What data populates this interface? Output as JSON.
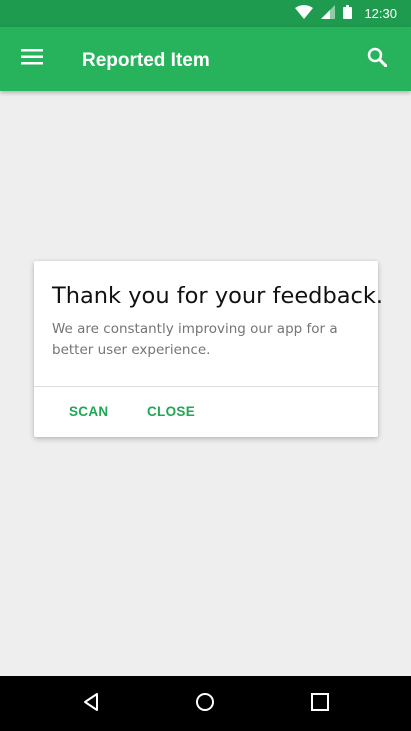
{
  "status_bar": {
    "time": "12:30",
    "icons": [
      "wifi-icon",
      "cell-signal-icon",
      "battery-icon"
    ]
  },
  "app_bar": {
    "title": "Reported Item",
    "left_icon": "menu-icon",
    "right_icon": "search-icon"
  },
  "dialog": {
    "title": "Thank you for your feedback.",
    "message": "We are constantly improving our app for a better user experience.",
    "buttons": {
      "scan": "SCAN",
      "close": "CLOSE"
    }
  },
  "nav_bar": {
    "icons": [
      "back-icon",
      "home-icon",
      "recents-icon"
    ]
  },
  "colors": {
    "status_bar": "#1f9b4f",
    "app_bar": "#26b35b",
    "accent": "#22a554",
    "background": "#eeeeee"
  }
}
